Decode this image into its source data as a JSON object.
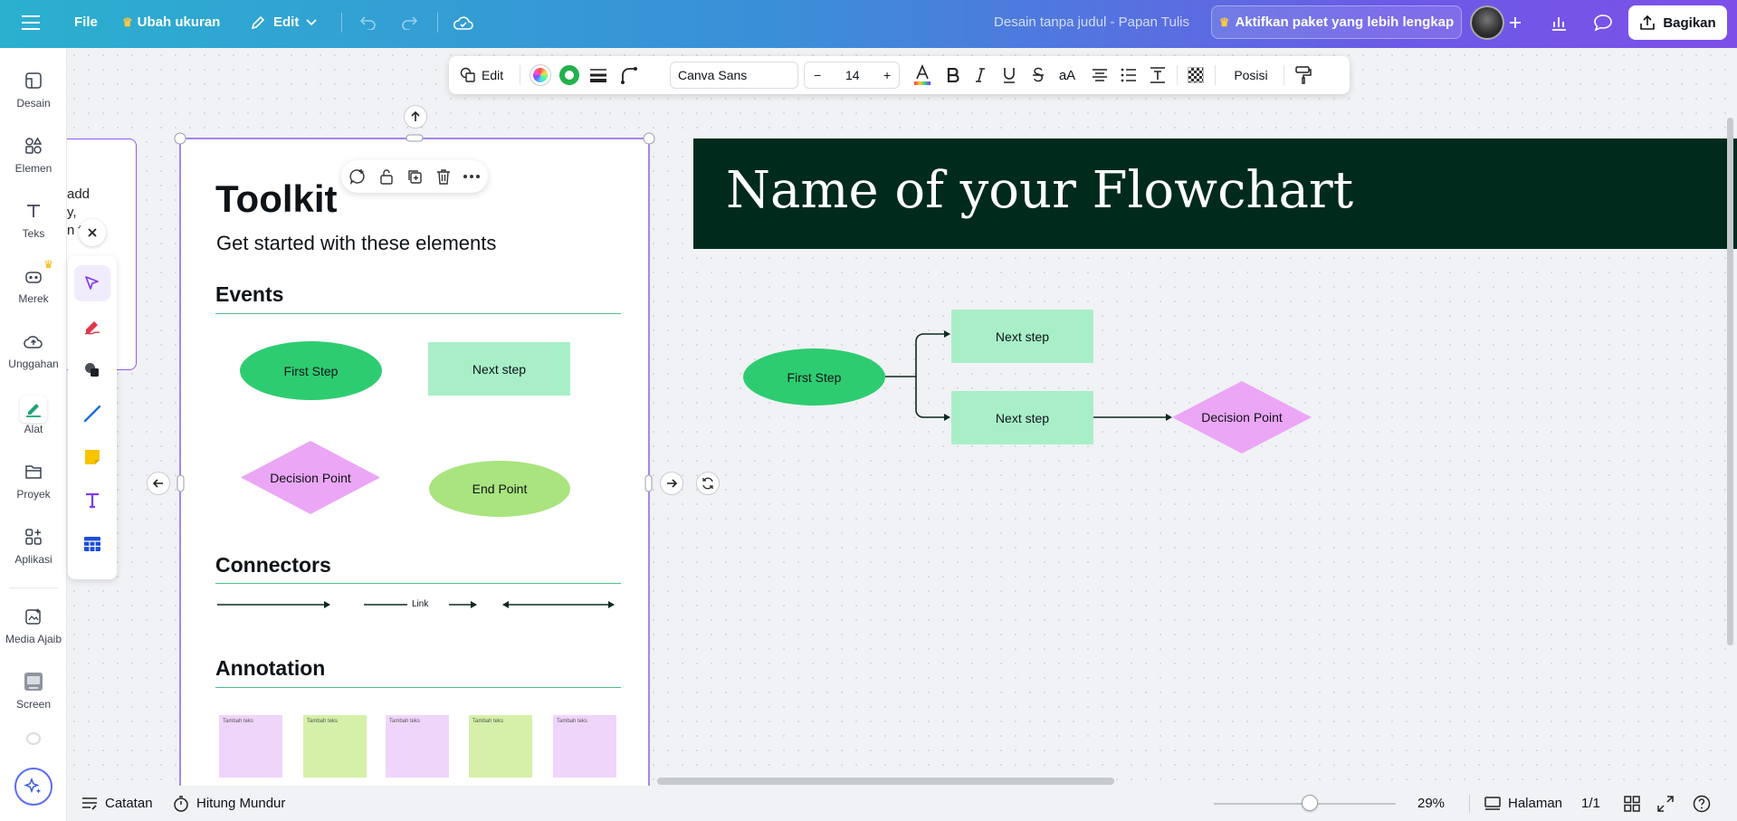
{
  "topbar": {
    "menu_icon": "hamburger-icon",
    "file_label": "File",
    "resize_label": "Ubah ukuran",
    "edit_label": "Edit",
    "doc_title": "Desain tanpa judul - Papan Tulis",
    "upgrade_label": "Aktifkan paket yang lebih lengkap",
    "share_label": "Bagikan",
    "crown_glyph": "♛"
  },
  "sidebar": {
    "items": [
      {
        "label": "Desain",
        "icon": "design-icon"
      },
      {
        "label": "Elemen",
        "icon": "elements-icon"
      },
      {
        "label": "Teks",
        "icon": "text-icon"
      },
      {
        "label": "Merek",
        "icon": "brand-icon"
      },
      {
        "label": "Unggahan",
        "icon": "upload-icon"
      },
      {
        "label": "Alat",
        "icon": "tools-icon"
      },
      {
        "label": "Proyek",
        "icon": "projects-icon"
      },
      {
        "label": "Aplikasi",
        "icon": "apps-icon"
      },
      {
        "label": "Media Ajaib",
        "icon": "magic-media-icon"
      },
      {
        "label": "Screen",
        "icon": "screen-icon"
      }
    ]
  },
  "context_toolbar": {
    "edit_label": "Edit",
    "font_name": "Canva Sans",
    "font_size": "14",
    "minus": "−",
    "plus": "+",
    "case_label": "aA",
    "position_label": "Posisi"
  },
  "left_fragment": {
    "lines": [
      "add",
      "y,",
      "n t    e"
    ]
  },
  "toolkit": {
    "title": "Toolkit",
    "subtitle": "Get started with these elements",
    "events_heading": "Events",
    "first_step": "First Step",
    "next_step": "Next step",
    "decision_point": "Decision Point",
    "end_point": "End Point",
    "connectors_heading": "Connectors",
    "link_label": "Link",
    "annotation_heading": "Annotation",
    "sticky_text": "Tambah teks",
    "sticky_colors": [
      "#f0d5fb",
      "#d5f0a8",
      "#f0d5fb",
      "#d5f0a8",
      "#f0d5fb"
    ]
  },
  "flowchart": {
    "title": "Name of your Flowchart",
    "first_step": "First Step",
    "next_step_1": "Next step",
    "next_step_2": "Next step",
    "decision_point": "Decision Point"
  },
  "colors": {
    "title_bg": "#002b1c",
    "green_ellipse": "#2ecc71",
    "mint_rect": "#a8efc8",
    "pink_diamond": "#eba6f5",
    "light_green_ellipse": "#a9e47f",
    "selection": "#8b5cf6"
  },
  "bottombar": {
    "notes_label": "Catatan",
    "timer_label": "Hitung Mundur",
    "zoom_percent": "29%",
    "zoom_level": 0.29,
    "pages_label": "Halaman",
    "page_count": "1/1"
  }
}
